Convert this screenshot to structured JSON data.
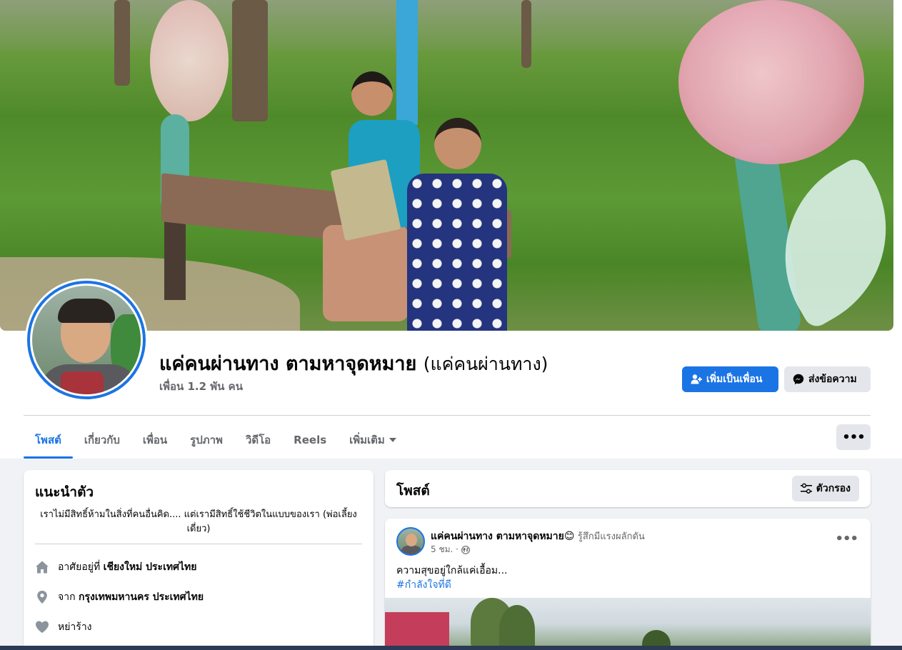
{
  "profile": {
    "name": "แค่คนผ่านทาง ตามหาจุดหมาย",
    "alternate_name": "(แค่คนผ่านทาง)",
    "friends": "เพื่อน 1.2 พัน คน"
  },
  "actions": {
    "add_friend": "เพิ่มเป็นเพื่อน",
    "message": "ส่งข้อความ",
    "more": "•••"
  },
  "tabs": [
    {
      "label": "โพสต์",
      "active": true
    },
    {
      "label": "เกี่ยวกับ"
    },
    {
      "label": "เพื่อน"
    },
    {
      "label": "รูปภาพ"
    },
    {
      "label": "วิดีโอ"
    },
    {
      "label": "Reels"
    },
    {
      "label": "เพิ่มเติม"
    }
  ],
  "intro": {
    "title": "แนะนำตัว",
    "bio": "เราไม่มีสิทธิ์ห้ามในสิ่งที่คนอื่นคิด.... แต่เรามีสิทธิ์ใช้ชีวิตในแบบของเรา (พ่อเลี้ยงเดี่ยว)",
    "lives_prefix": "อาศัยอยู่ที่",
    "lives_place": "เชียงใหม่ ประเทศไทย",
    "from_prefix": "จาก",
    "from_place": "กรุงเทพมหานคร ประเทศไทย",
    "relationship": "หย่าร้าง"
  },
  "posts_section": {
    "title": "โพสต์",
    "filter_label": "ตัวกรอง"
  },
  "post": {
    "author": "แค่คนผ่านทาง ตามหาจุดหมาย",
    "emoji": "😊",
    "feeling": "รู้สึกมีแรงผลักดัน",
    "time": "5 ชม. ·",
    "text": "ความสุขอยู่ใกล้แค่เอื้อม...",
    "hashtag": "#กำลังใจที่ดี"
  },
  "colors": {
    "accent": "#1b74e4",
    "secondary_button": "#e4e6eb",
    "page_background": "#f0f2f5"
  }
}
